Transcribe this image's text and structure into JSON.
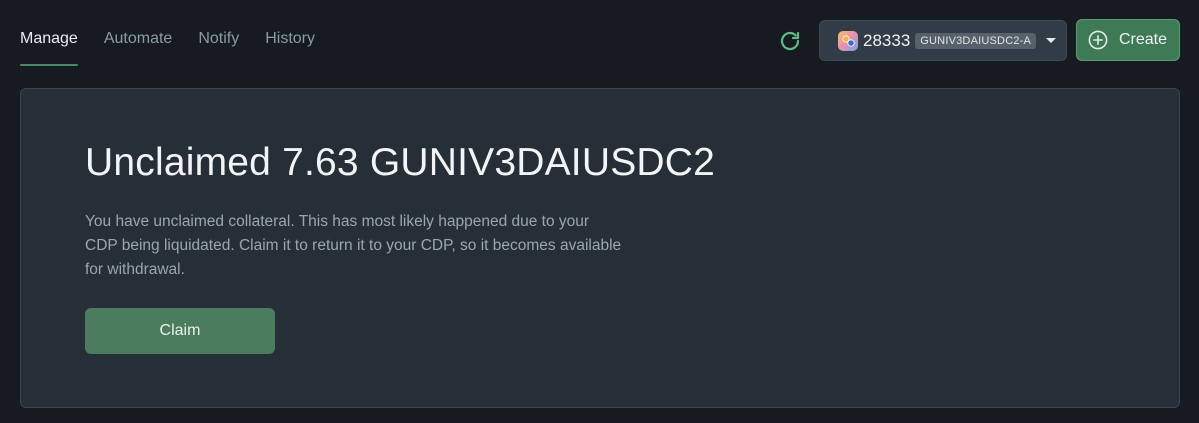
{
  "nav": {
    "tabs": [
      {
        "label": "Manage",
        "active": true
      },
      {
        "label": "Automate",
        "active": false
      },
      {
        "label": "Notify",
        "active": false
      },
      {
        "label": "History",
        "active": false
      }
    ]
  },
  "header": {
    "refresh_icon": "refresh-icon",
    "vault_selector": {
      "vault_id": "28333",
      "ilk": "GUNIV3DAIUSDC2-A",
      "logo_icon": "token-logo-icon",
      "caret_icon": "caret-down-icon"
    },
    "create_button": {
      "label": "Create",
      "icon": "plus-circle-icon"
    }
  },
  "card": {
    "title": "Unclaimed 7.63 GUNIV3DAIUSDC2",
    "description": "You have unclaimed collateral. This has most likely happened due to your CDP being liquidated. Claim it to return it to your CDP, so it becomes available for withdrawal.",
    "claim_button": {
      "label": "Claim"
    }
  },
  "colors": {
    "background": "#161b21",
    "card_background": "#262f37",
    "accent_green": "#4b7c5e",
    "refresh_green": "#5dbb84"
  }
}
